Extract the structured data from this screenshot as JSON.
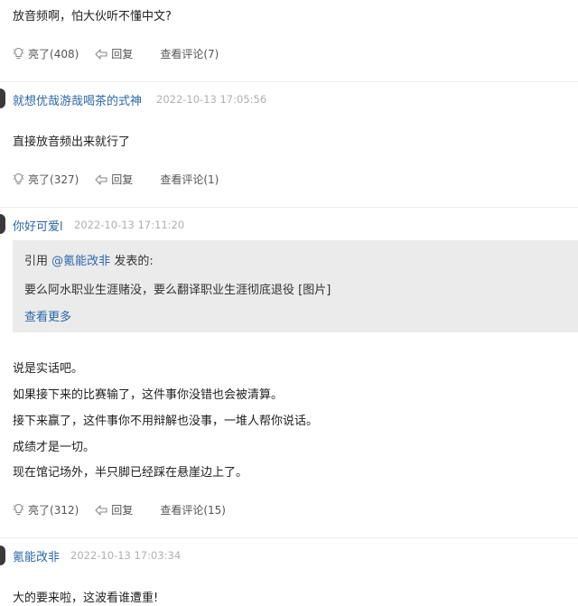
{
  "actions": {
    "like_prefix": "亮了",
    "reply": "回复",
    "view_prefix": "查看评论"
  },
  "top_block": {
    "text": "放音频啊，怕大伙听不懂中文?",
    "likes": "(408)",
    "comments": "(7)"
  },
  "comment2": {
    "user": "就想优哉游哉喝茶的式神",
    "time": "2022-10-13 17:05:56",
    "text": "直接放音频出来就行了",
    "likes": "(327)",
    "comments": "(1)"
  },
  "comment3": {
    "user": "你好可爱l",
    "time": "2022-10-13 17:11:20",
    "quote": {
      "prefix": "引用",
      "at_user": "@氪能改非",
      "suffix": "发表的:",
      "text": "要么阿水职业生涯赌没，要么翻译职业生涯彻底退役 [图片]",
      "more": "查看更多"
    },
    "lines": [
      "说是实话吧。",
      "如果接下来的比赛输了，这件事你没错也会被清算。",
      "接下来赢了，这件事你不用辩解也没事，一堆人帮你说话。",
      "成绩才是一切。",
      "现在馆记场外，半只脚已经踩在悬崖边上了。"
    ],
    "likes": "(312)",
    "comments": "(15)"
  },
  "comment4": {
    "user": "氪能改非",
    "time": "2022-10-13 17:03:34",
    "text": "大的要来啦，这波看谁遭重!"
  },
  "colors": {
    "link": "#2b66a8",
    "quote_bg": "#ebebeb",
    "time": "#b0b0b0",
    "separator": "#ececec"
  },
  "icons": {
    "like": "lightbulb-icon",
    "reply": "reply-arrow-icon"
  }
}
